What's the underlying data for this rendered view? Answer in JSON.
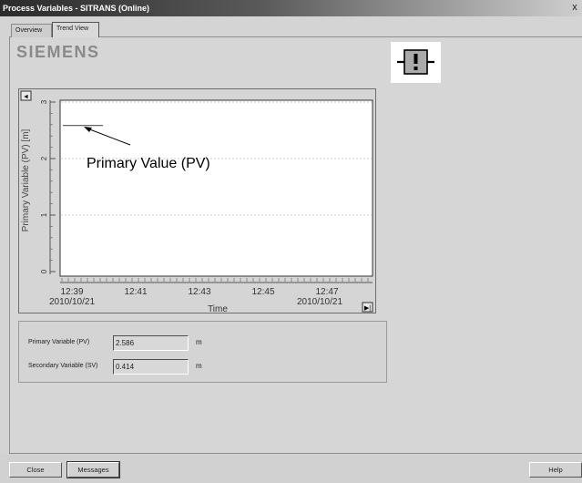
{
  "window": {
    "title": "Process Variables - SITRANS  (Online)",
    "close_glyph": "x"
  },
  "tabs": [
    {
      "label": "Overview",
      "active": false
    },
    {
      "label": "Trend View",
      "active": true
    }
  ],
  "brand": {
    "logo_text": "SIEMENS"
  },
  "alarm": {
    "icon": "maintenance-alarm-icon"
  },
  "annotation": {
    "text": "Primary Value (PV)"
  },
  "chart_data": {
    "type": "line",
    "ylabel": "Primary Variable (PV) [m]",
    "xlabel": "Time",
    "ylim": [
      0,
      3
    ],
    "y_ticks": [
      0,
      1,
      2,
      3
    ],
    "x_ticks": [
      {
        "time": "12:39",
        "date": "2010/10/21"
      },
      {
        "time": "12:41",
        "date": ""
      },
      {
        "time": "12:43",
        "date": ""
      },
      {
        "time": "12:45",
        "date": ""
      },
      {
        "time": "12:47",
        "date": "2010/10/21"
      }
    ],
    "series": [
      {
        "values": [
          2.586,
          2.586,
          2.586,
          2.586,
          2.586
        ]
      }
    ],
    "grid": "horizontal dashed",
    "scroll_left_glyph": "◄",
    "scroll_right_glyph": "▶|"
  },
  "values": {
    "pv": {
      "label": "Primary Variable (PV)",
      "value": "2.586",
      "unit": "m"
    },
    "sv": {
      "label": "Secondary Variable (SV)",
      "value": "0.414",
      "unit": "m"
    }
  },
  "buttons": {
    "close": "Close",
    "messages": "Messages",
    "help": "Help"
  }
}
